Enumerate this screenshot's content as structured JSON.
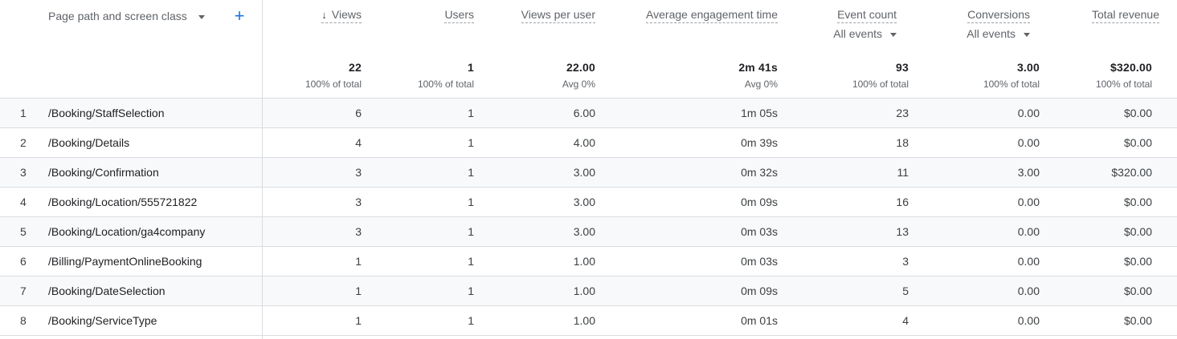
{
  "dimension": {
    "label": "Page path and screen class"
  },
  "metrics": {
    "views": {
      "label": "Views",
      "total": "22",
      "total_sub": "100% of total"
    },
    "users": {
      "label": "Users",
      "total": "1",
      "total_sub": "100% of total"
    },
    "views_per_user": {
      "label": "Views per user",
      "total": "22.00",
      "total_sub": "Avg 0%"
    },
    "avg_engagement": {
      "label": "Average engagement time",
      "total": "2m 41s",
      "total_sub": "Avg 0%"
    },
    "event_count": {
      "label": "Event count",
      "filter": "All events",
      "total": "93",
      "total_sub": "100% of total"
    },
    "conversions": {
      "label": "Conversions",
      "filter": "All events",
      "total": "3.00",
      "total_sub": "100% of total"
    },
    "total_revenue": {
      "label": "Total revenue",
      "total": "$320.00",
      "total_sub": "100% of total"
    }
  },
  "rows": [
    {
      "idx": "1",
      "path": "/Booking/StaffSelection",
      "views": "6",
      "users": "1",
      "vpu": "6.00",
      "aet": "1m 05s",
      "events": "23",
      "conv": "0.00",
      "rev": "$0.00"
    },
    {
      "idx": "2",
      "path": "/Booking/Details",
      "views": "4",
      "users": "1",
      "vpu": "4.00",
      "aet": "0m 39s",
      "events": "18",
      "conv": "0.00",
      "rev": "$0.00"
    },
    {
      "idx": "3",
      "path": "/Booking/Confirmation",
      "views": "3",
      "users": "1",
      "vpu": "3.00",
      "aet": "0m 32s",
      "events": "11",
      "conv": "3.00",
      "rev": "$320.00"
    },
    {
      "idx": "4",
      "path": "/Booking/Location/555721822",
      "views": "3",
      "users": "1",
      "vpu": "3.00",
      "aet": "0m 09s",
      "events": "16",
      "conv": "0.00",
      "rev": "$0.00"
    },
    {
      "idx": "5",
      "path": "/Booking/Location/ga4company",
      "views": "3",
      "users": "1",
      "vpu": "3.00",
      "aet": "0m 03s",
      "events": "13",
      "conv": "0.00",
      "rev": "$0.00"
    },
    {
      "idx": "6",
      "path": "/Billing/PaymentOnlineBooking",
      "views": "1",
      "users": "1",
      "vpu": "1.00",
      "aet": "0m 03s",
      "events": "3",
      "conv": "0.00",
      "rev": "$0.00"
    },
    {
      "idx": "7",
      "path": "/Booking/DateSelection",
      "views": "1",
      "users": "1",
      "vpu": "1.00",
      "aet": "0m 09s",
      "events": "5",
      "conv": "0.00",
      "rev": "$0.00"
    },
    {
      "idx": "8",
      "path": "/Booking/ServiceType",
      "views": "1",
      "users": "1",
      "vpu": "1.00",
      "aet": "0m 01s",
      "events": "4",
      "conv": "0.00",
      "rev": "$0.00"
    }
  ]
}
